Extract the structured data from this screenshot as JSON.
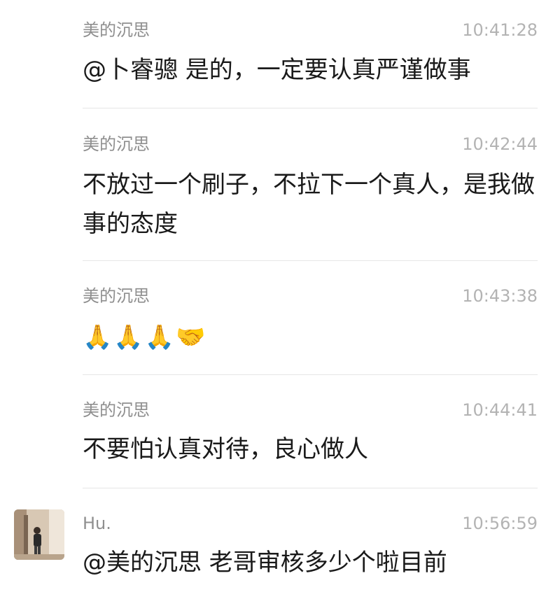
{
  "messages": [
    {
      "sender": "美的沉思",
      "time": "10:41:28",
      "text": "@卜睿骢 是的，一定要认真严谨做事"
    },
    {
      "sender": "美的沉思",
      "time": "10:42:44",
      "text": "不放过一个刷子，不拉下一个真人，是我做事的态度"
    },
    {
      "sender": "美的沉思",
      "time": "10:43:38",
      "text": "🙏🙏🙏🤝"
    },
    {
      "sender": "美的沉思",
      "time": "10:44:41",
      "text": "不要怕认真对待，良心做人"
    },
    {
      "sender": "Hu.",
      "time": "10:56:59",
      "text": "@美的沉思 老哥审核多少个啦目前"
    }
  ]
}
